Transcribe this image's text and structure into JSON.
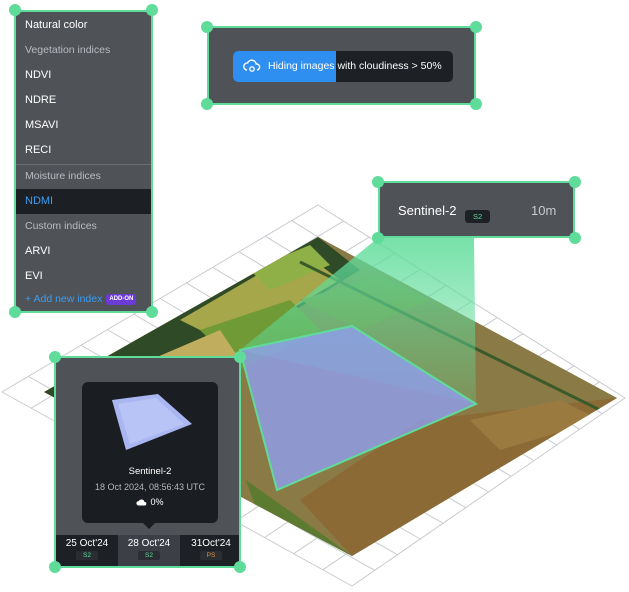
{
  "index_menu": {
    "natural_color": "Natural color",
    "vegetation_group": "Vegetation indices",
    "vegetation_items": [
      "NDVI",
      "NDRE",
      "MSAVI",
      "RECI"
    ],
    "moisture_group": "Moisture indices",
    "moisture_selected": "NDMI",
    "custom_group": "Custom indices",
    "custom_items": [
      "ARVI",
      "EVI"
    ],
    "add_new_index": "+ Add new index",
    "addon_badge": "ADD-ON"
  },
  "cloud_notice": {
    "highlight": "Hiding images",
    "rest": " with cloudiness > 50%"
  },
  "sentinel_panel": {
    "name": "Sentinel-2",
    "badge": "S2",
    "resolution": "10m"
  },
  "date_panel": {
    "preview_satellite": "Sentinel-2",
    "preview_datetime": "18 Oct 2024, 08:56:43 UTC",
    "preview_cloudiness": "0%",
    "dates": [
      {
        "date": "25 Oct'24",
        "badge": "S2",
        "badge_color": "#5fdc9a"
      },
      {
        "date": "28 Oct'24",
        "badge": "S2",
        "badge_color": "#5fdc9a",
        "active": true
      },
      {
        "date": "31Oct'24",
        "badge": "PS",
        "badge_color": "#e08a3c"
      }
    ]
  },
  "colors": {
    "accent_green": "#5fdc9a",
    "accent_blue": "#2e8ff0",
    "panel_bg": "#4f5257",
    "dark_bg": "#1d2024",
    "selection_overlay": "#8f9ff0",
    "addon_purple": "#6c3bd6"
  }
}
